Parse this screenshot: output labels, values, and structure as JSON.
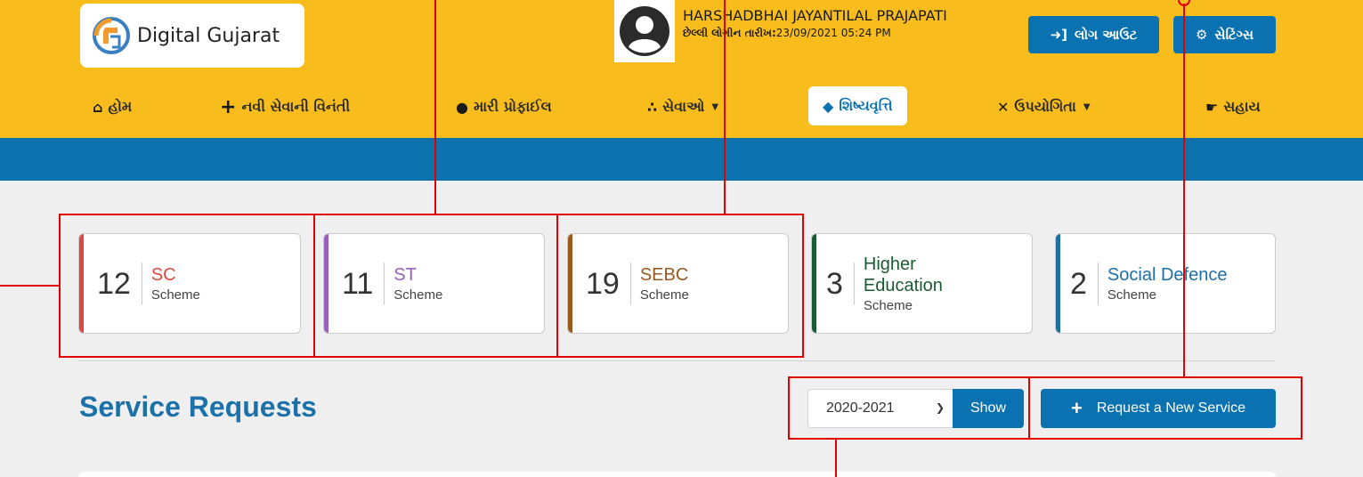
{
  "header": {
    "logo_text": "Digital Gujarat",
    "user_name": "HARSHADBHAI JAYANTILAL PRAJAPATI",
    "last_login_label": "છેલ્લી લોગીન તારીખ:",
    "last_login_value": "23/09/2021 05:24 PM",
    "logout_label": "લોગ આઉટ",
    "settings_label": "સેટિંગ્સ"
  },
  "nav": {
    "items": [
      {
        "label": "હોમ",
        "icon": "home-icon"
      },
      {
        "label": "નવી સેવાની વિનંતી",
        "icon": "plus-icon"
      },
      {
        "label": "મારી પ્રોફાઈલ",
        "icon": "user-icon"
      },
      {
        "label": "સેવાઓ",
        "icon": "users-icon",
        "has_dropdown": true
      },
      {
        "label": "શિષ્યવૃત્તિ",
        "icon": "graduation-cap-icon",
        "active": true
      },
      {
        "label": "ઉપયોગિતા",
        "icon": "tools-icon",
        "has_dropdown": true
      },
      {
        "label": "સહાય",
        "icon": "handshake-icon"
      }
    ]
  },
  "schemes": [
    {
      "count": "12",
      "title": "SC",
      "subtitle": "Scheme",
      "color": "#e0483f"
    },
    {
      "count": "11",
      "title": "ST",
      "subtitle": "Scheme",
      "color": "#9b5fc0"
    },
    {
      "count": "19",
      "title": "SEBC",
      "subtitle": "Scheme",
      "color": "#9a5a1e"
    },
    {
      "count": "3",
      "title_line1": "Higher",
      "title_line2": "Education",
      "subtitle": "Scheme",
      "color": "#1c5a34"
    },
    {
      "count": "2",
      "title": "Social Defence",
      "subtitle": "Scheme",
      "color": "#1e6fa6"
    }
  ],
  "service_requests": {
    "title": "Service Requests",
    "year_selected": "2020-2021",
    "show_label": "Show",
    "new_service_label": "Request a New Service"
  },
  "colors": {
    "header_bg": "#f8bc1c",
    "primary": "#0b72b2",
    "annotation": "#e00000"
  }
}
